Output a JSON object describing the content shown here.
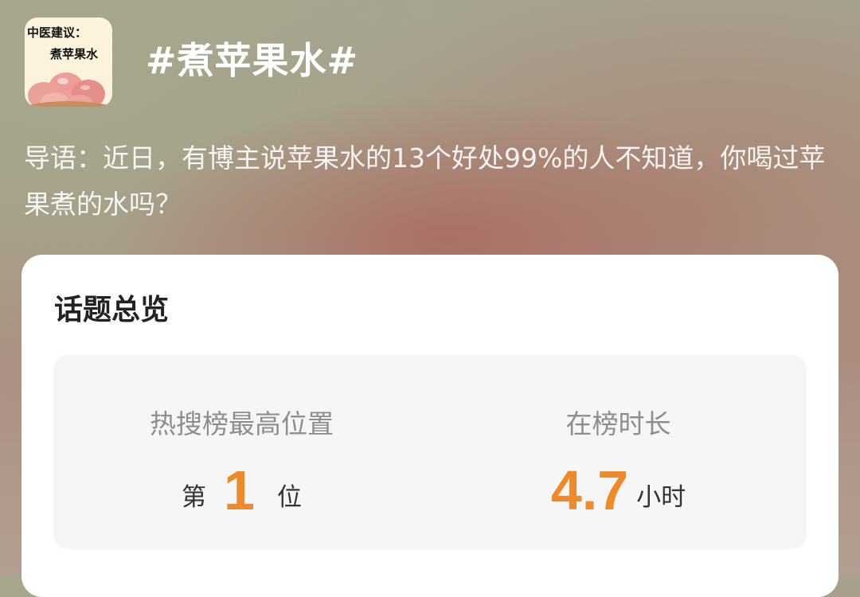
{
  "header": {
    "thumbnail": {
      "line1": "中医建议：",
      "line2": "煮苹果水"
    },
    "title": "#煮苹果水#"
  },
  "intro": {
    "text": "导语：近日，有博主说苹果水的13个好处99%的人不知道，你喝过苹果煮的水吗？"
  },
  "overview": {
    "title": "话题总览",
    "stats": [
      {
        "label": "热搜榜最高位置",
        "prefix": "第",
        "value": "1",
        "unit": "位"
      },
      {
        "label": "在榜时长",
        "prefix": "",
        "value": "4.7",
        "unit": "小时"
      }
    ]
  },
  "colors": {
    "accent": "#f08a28",
    "card_bg": "#ffffff",
    "stats_bg": "#f6f6f6",
    "label_gray": "#8e8e8e"
  }
}
